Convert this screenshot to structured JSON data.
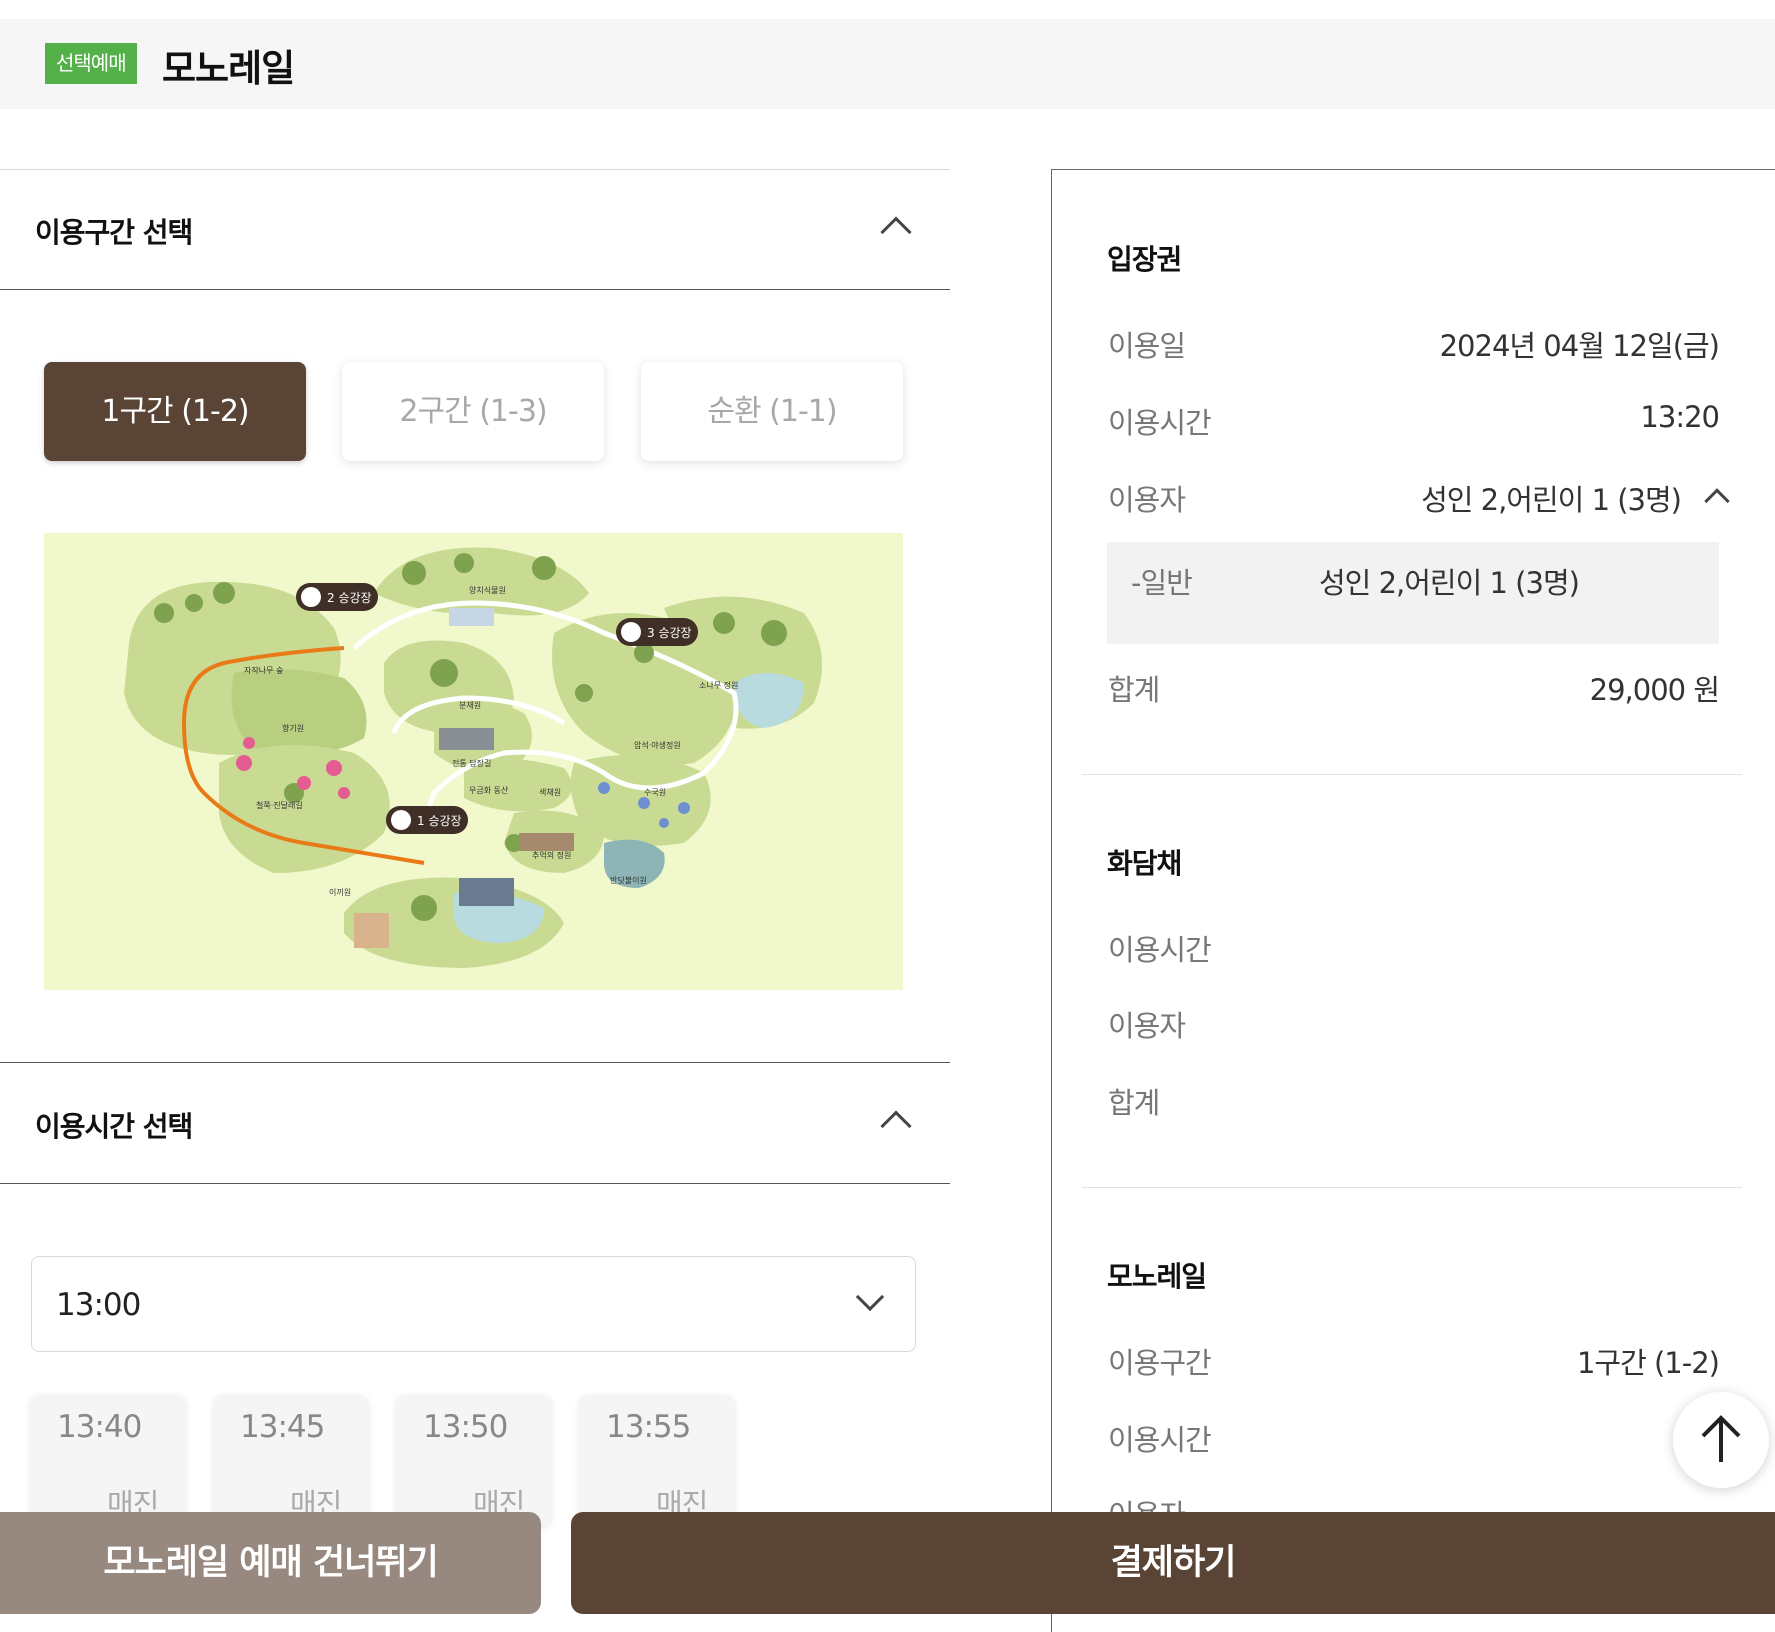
{
  "header": {
    "badge": "선택예매",
    "title": "모노레일"
  },
  "route_section": {
    "title": "이용구간 선택",
    "options": [
      {
        "label": "1구간 (1-2)",
        "selected": true
      },
      {
        "label": "2구간 (1-3)",
        "selected": false
      },
      {
        "label": "순환 (1-1)",
        "selected": false
      }
    ],
    "map_labels": {
      "station_1": "1 승강장",
      "station_2": "2 승강장",
      "station_3": "3 승강장",
      "areas": [
        "양치식물원",
        "자작나무 숲",
        "분재원",
        "소나무 정원",
        "암석·야생정원",
        "철쭉·진달래길",
        "전통 담장길",
        "우금화 동산",
        "색채원",
        "수국원",
        "추억의 정원",
        "반딧불이원",
        "이끼원",
        "향기원"
      ]
    }
  },
  "time_section": {
    "title": "이용시간 선택",
    "selected_value": "13:00",
    "slots": [
      {
        "time": "13:40",
        "status": "매진"
      },
      {
        "time": "13:45",
        "status": "매진"
      },
      {
        "time": "13:50",
        "status": "매진"
      },
      {
        "time": "13:55",
        "status": "매진"
      }
    ]
  },
  "summary": {
    "admission": {
      "heading": "입장권",
      "date_label": "이용일",
      "date_value": "2024년 04월 12일(금)",
      "time_label": "이용시간",
      "time_value": "13:20",
      "users_label": "이용자",
      "users_value": "성인 2,어린이 1 (3명)",
      "sub_label": "-일반",
      "sub_value": "성인 2,어린이 1 (3명)",
      "total_label": "합계",
      "total_value": "29,000 원"
    },
    "hwadamchae": {
      "heading": "화담채",
      "time_label": "이용시간",
      "users_label": "이용자",
      "total_label": "합계"
    },
    "monorail": {
      "heading": "모노레일",
      "route_label": "이용구간",
      "route_value": "1구간 (1-2)",
      "time_label": "이용시간",
      "users_label": "이용자"
    }
  },
  "actions": {
    "skip_label": "모노레일 예매 건너뛰기",
    "pay_label": "결제하기"
  },
  "colors": {
    "brand_brown": "#5a4436",
    "badge_green": "#54b14a",
    "skip_gray": "#978880",
    "map_bg": "#f1f8cc",
    "route_line": "#e97a18"
  }
}
